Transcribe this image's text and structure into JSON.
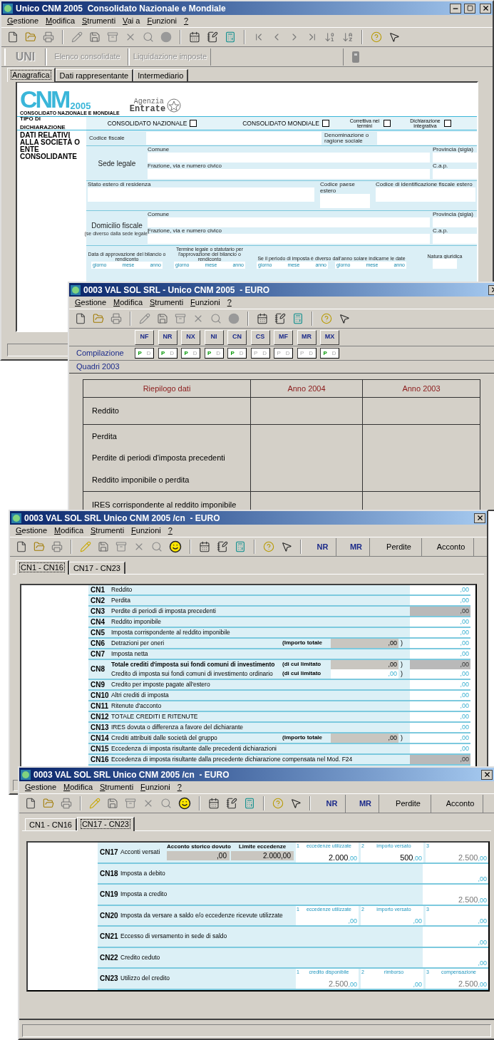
{
  "main_window": {
    "title": "Unico CNM 2005  Consolidato Nazionale e Mondiale",
    "menu": [
      "Gestione",
      "Modifica",
      "Strumenti",
      "Vai a",
      "Funzioni",
      "?"
    ],
    "nav_buttons": [
      {
        "label": "UNI",
        "kind": "code",
        "disabled": true
      },
      {
        "label": "Elenco consolidate",
        "kind": "text",
        "disabled": true
      },
      {
        "label": "Liquidazione imposte",
        "kind": "text",
        "disabled": true
      }
    ],
    "tabs": [
      {
        "label": "Anagrafica",
        "selected": true
      },
      {
        "label": "Dati rappresentante",
        "selected": false
      },
      {
        "label": "Intermediario",
        "selected": false
      }
    ],
    "form": {
      "logo": {
        "mark": "CNM",
        "year": "2005",
        "subtitle": "CONSOLIDATO NAZIONALE E MONDIALE",
        "agency": [
          "Agenzia",
          "Entrate"
        ]
      },
      "declaration_type": {
        "label": "TIPO DI DICHIARAZIONE",
        "options": [
          {
            "label": "CONSOLIDATO NAZIONALE",
            "checked": false
          },
          {
            "label": "CONSOLIDATO MONDIALE",
            "checked": false
          },
          {
            "label": "Correttiva nei termini",
            "checked": false
          },
          {
            "label": "Dichiarazione integrativa",
            "checked": false
          }
        ]
      },
      "section_title": "DATI RELATIVI ALLA SOCIETÀ O ENTE CONSOLIDANTE",
      "codice_fiscale": "Codice fiscale",
      "denominazione": "Denominazione o ragione sociale",
      "sede_legale": {
        "label": "Sede legale",
        "comune": "Comune",
        "provincia": "Provincia (sigla)",
        "indirizzo": "Frazione, via e numero civico",
        "cap": "C.a.p."
      },
      "stato_estero": "Stato estero di residenza",
      "codice_paese": "Codice paese estero",
      "codice_id_estero": "Codice di identificazione fiscale estero",
      "domicilio_fiscale": {
        "label": "Domicilio fiscale",
        "note": "(se diverso dalla sede legale)",
        "comune": "Comune",
        "provincia": "Provincia (sigla)",
        "indirizzo": "Frazione, via e numero civico",
        "cap": "C.a.p."
      },
      "dates": {
        "approvazione": "Data di approvazione del bilancio o rendiconto",
        "termine": "Termine legale o statutario per l'approvazione del bilancio o rendiconto",
        "periodo": "Se il periodo di imposta è diverso dall'anno solare indicarne le date",
        "natura": "Natura giuridica",
        "boxes": [
          {
            "parts": [
              "giorno",
              "mese",
              "anno"
            ]
          },
          {
            "parts": [
              "giorno",
              "mese",
              "anno"
            ]
          },
          {
            "parts": [
              "giorno",
              "mese",
              "anno"
            ]
          },
          {
            "parts": [
              "giorno",
              "mese",
              "anno"
            ]
          }
        ]
      }
    }
  },
  "summary_window": {
    "title": "0003 VAL SOL SRL - Unico CNM 2005  - EURO",
    "menu": [
      "Gestione",
      "Modifica",
      "Strumenti",
      "Funzioni",
      "?"
    ],
    "quadri": [
      {
        "label": "NF",
        "p": "P",
        "d": "D",
        "p_active": true
      },
      {
        "label": "NR",
        "p": "P",
        "d": "D",
        "p_active": true
      },
      {
        "label": "NX",
        "p": "P",
        "d": "D",
        "p_active": true
      },
      {
        "label": "NI",
        "p": "P",
        "d": "D",
        "p_active": true
      },
      {
        "label": "CN",
        "p": "P",
        "d": "D",
        "p_active": true
      },
      {
        "label": "CS",
        "p": "P",
        "d": "D",
        "p_active": false
      },
      {
        "label": "MF",
        "p": "P",
        "d": "D",
        "p_active": false
      },
      {
        "label": "MR",
        "p": "P",
        "d": "D",
        "p_active": false
      },
      {
        "label": "MX",
        "p": "P",
        "d": "D",
        "p_active": true
      }
    ],
    "row_labels": [
      "Compilazione",
      "Quadri 2003"
    ],
    "table": {
      "columns": [
        "Riepilogo dati",
        "Anno 2004",
        "Anno 2003"
      ],
      "groups": [
        {
          "rows": [
            "Reddito"
          ]
        },
        {
          "rows": [
            "Perdita",
            "Perdite di periodi d'imposta precedenti",
            "Reddito imponibile o perdita"
          ]
        },
        {
          "rows": [
            "IRES corrispondente al reddito imponibile"
          ]
        }
      ]
    }
  },
  "cn_window_1": {
    "title": "0003 VAL SOL SRL Unico CNM 2005 /cn  - EURO",
    "menu": [
      "Gestione",
      "Modifica",
      "Strumenti",
      "Funzioni",
      "?"
    ],
    "toolbar_buttons": [
      {
        "label": "NR",
        "kind": "code"
      },
      {
        "label": "MR",
        "kind": "code"
      },
      {
        "label": "Perdite",
        "kind": "text"
      },
      {
        "label": "Acconto",
        "kind": "text"
      }
    ],
    "tabs": [
      {
        "label": "CN1 - CN16",
        "selected": true
      },
      {
        "label": "CN17 - CN23",
        "selected": false
      }
    ],
    "rows": [
      {
        "code": "CN1",
        "lines": [
          {
            "label": "Reddito",
            "value": {
              "text": ",00",
              "disabled": false
            }
          }
        ]
      },
      {
        "code": "CN2",
        "lines": [
          {
            "label": "Perdita",
            "value": {
              "text": ",00",
              "disabled": false
            }
          }
        ]
      },
      {
        "code": "CN3",
        "lines": [
          {
            "label": "Perdite di periodi di imposta precedenti",
            "value": {
              "text": ",00",
              "disabled": true
            }
          }
        ]
      },
      {
        "code": "CN4",
        "lines": [
          {
            "label": "Reddito imponibile",
            "value": {
              "text": ",00",
              "disabled": false
            }
          }
        ]
      },
      {
        "code": "CN5",
        "lines": [
          {
            "label": "Imposta corrispondente al reddito imponibile",
            "value": {
              "text": ",00",
              "disabled": false
            }
          }
        ]
      },
      {
        "code": "CN6",
        "lines": [
          {
            "label": "Detrazioni per oneri",
            "aside": {
              "label": "(Importo totale",
              "value": {
                "text": ",00",
                "disabled": true
              },
              "close": ")"
            },
            "value": {
              "text": ",00",
              "disabled": false
            }
          }
        ]
      },
      {
        "code": "CN7",
        "lines": [
          {
            "label": "Imposta netta",
            "value": {
              "text": ",00",
              "disabled": false
            }
          }
        ]
      },
      {
        "code": "CN8",
        "lines": [
          {
            "label": "Totale crediti d'imposta sui fondi comuni di investimento",
            "emphasis": true,
            "aside": {
              "label": "(di cui limitato",
              "value": {
                "text": ",00",
                "disabled": true
              },
              "close": ")"
            },
            "value": {
              "text": ",00",
              "disabled": true
            }
          },
          {
            "label": "Credito di imposta sui fondi comuni di investimento ordinario",
            "emphasis": false,
            "aside": {
              "label": "(di cui limitato",
              "value": {
                "text": ",00",
                "disabled": false
              },
              "close": ")"
            },
            "value": {
              "text": ",00",
              "disabled": false
            }
          }
        ]
      },
      {
        "code": "CN9",
        "lines": [
          {
            "label": "Credito per imposte pagate all'estero",
            "value": {
              "text": ",00",
              "disabled": false
            }
          }
        ]
      },
      {
        "code": "CN10",
        "lines": [
          {
            "label": "Altri crediti di imposta",
            "value": {
              "text": ",00",
              "disabled": false
            }
          }
        ]
      },
      {
        "code": "CN11",
        "lines": [
          {
            "label": "Ritenute d'acconto",
            "value": {
              "text": ",00",
              "disabled": false
            }
          }
        ]
      },
      {
        "code": "CN12",
        "lines": [
          {
            "label": "TOTALE CREDITI E RITENUTE",
            "value": {
              "text": ",00",
              "disabled": false
            }
          }
        ]
      },
      {
        "code": "CN13",
        "lines": [
          {
            "label": "IRES dovuta o differenza a favore del dichiarante",
            "value": {
              "text": ",00",
              "disabled": false
            }
          }
        ]
      },
      {
        "code": "CN14",
        "lines": [
          {
            "label": "Crediti attribuiti dalle società del gruppo",
            "aside": {
              "label": "(Importo totale",
              "value": {
                "text": ",00",
                "disabled": true
              },
              "close": ")"
            },
            "value": {
              "text": ",00",
              "disabled": false
            }
          }
        ]
      },
      {
        "code": "CN15",
        "lines": [
          {
            "label": "Eccedenza di imposta risultante dalle precedenti dichiarazioni",
            "value": {
              "text": ",00",
              "disabled": false
            }
          }
        ]
      },
      {
        "code": "CN16",
        "lines": [
          {
            "label": "Eccedenza di imposta risultante dalla precedente dichiarazione compensata nel Mod. F24",
            "value": {
              "text": ",00",
              "disabled": true
            }
          }
        ]
      }
    ]
  },
  "cn_window_2": {
    "title": "0003 VAL SOL SRL Unico CNM 2005 /cn  - EURO",
    "menu": [
      "Gestione",
      "Modifica",
      "Strumenti",
      "Funzioni",
      "?"
    ],
    "toolbar_buttons": [
      {
        "label": "NR",
        "kind": "code"
      },
      {
        "label": "MR",
        "kind": "code"
      },
      {
        "label": "Perdite",
        "kind": "text"
      },
      {
        "label": "Acconto",
        "kind": "text"
      }
    ],
    "tabs": [
      {
        "label": "CN1 - CN16",
        "selected": false
      },
      {
        "label": "CN17 - CN23",
        "selected": true
      }
    ],
    "rows": [
      {
        "code": "CN17",
        "label": "Acconti versati",
        "kind": "triple",
        "extras": [
          {
            "label": "Acconto storico dovuto",
            "value": ",00"
          },
          {
            "label": "Limite eccedenze",
            "value": "2.000,00"
          }
        ],
        "cells": [
          {
            "num": "1",
            "caption": "eccedenze utilizzate",
            "amount": "2.000",
            "decimals": ",00",
            "computed": false
          },
          {
            "num": "2",
            "caption": "importo versato",
            "amount": "500",
            "decimals": ",00",
            "computed": false
          },
          {
            "num": "3",
            "amount": "2.500",
            "decimals": ",00",
            "computed": true
          }
        ]
      },
      {
        "code": "CN18",
        "label": "Imposta a debito",
        "kind": "single",
        "cells": [
          {
            "decimals": ",00"
          }
        ]
      },
      {
        "code": "CN19",
        "label": "Imposta a credito",
        "kind": "single",
        "cells": [
          {
            "amount": "2.500",
            "decimals": ",00",
            "computed": true
          }
        ]
      },
      {
        "code": "CN20",
        "label": "Imposta da versare a saldo e/o eccedenze ricevute utilizzate",
        "kind": "triple",
        "cells": [
          {
            "num": "1",
            "caption": "eccedenze utilizzate",
            "decimals": ",00"
          },
          {
            "num": "2",
            "caption": "importo versato",
            "decimals": ",00"
          },
          {
            "num": "3",
            "decimals": ",00"
          }
        ]
      },
      {
        "code": "CN21",
        "label": "Eccesso di versamento in sede di saldo",
        "kind": "single",
        "cells": [
          {
            "decimals": ",00"
          }
        ]
      },
      {
        "code": "CN22",
        "label": "Credito ceduto",
        "kind": "single",
        "cells": [
          {
            "decimals": ",00"
          }
        ]
      },
      {
        "code": "CN23",
        "label": "Utilizzo del credito",
        "kind": "triple",
        "cells": [
          {
            "num": "1",
            "caption": "credito disponibile",
            "amount": "2.500",
            "decimals": ",00",
            "computed": true
          },
          {
            "num": "2",
            "caption": "rimborso",
            "decimals": ",00"
          },
          {
            "num": "3",
            "caption": "compensazione",
            "amount": "2.500",
            "decimals": ",00",
            "computed": true
          }
        ]
      }
    ]
  }
}
